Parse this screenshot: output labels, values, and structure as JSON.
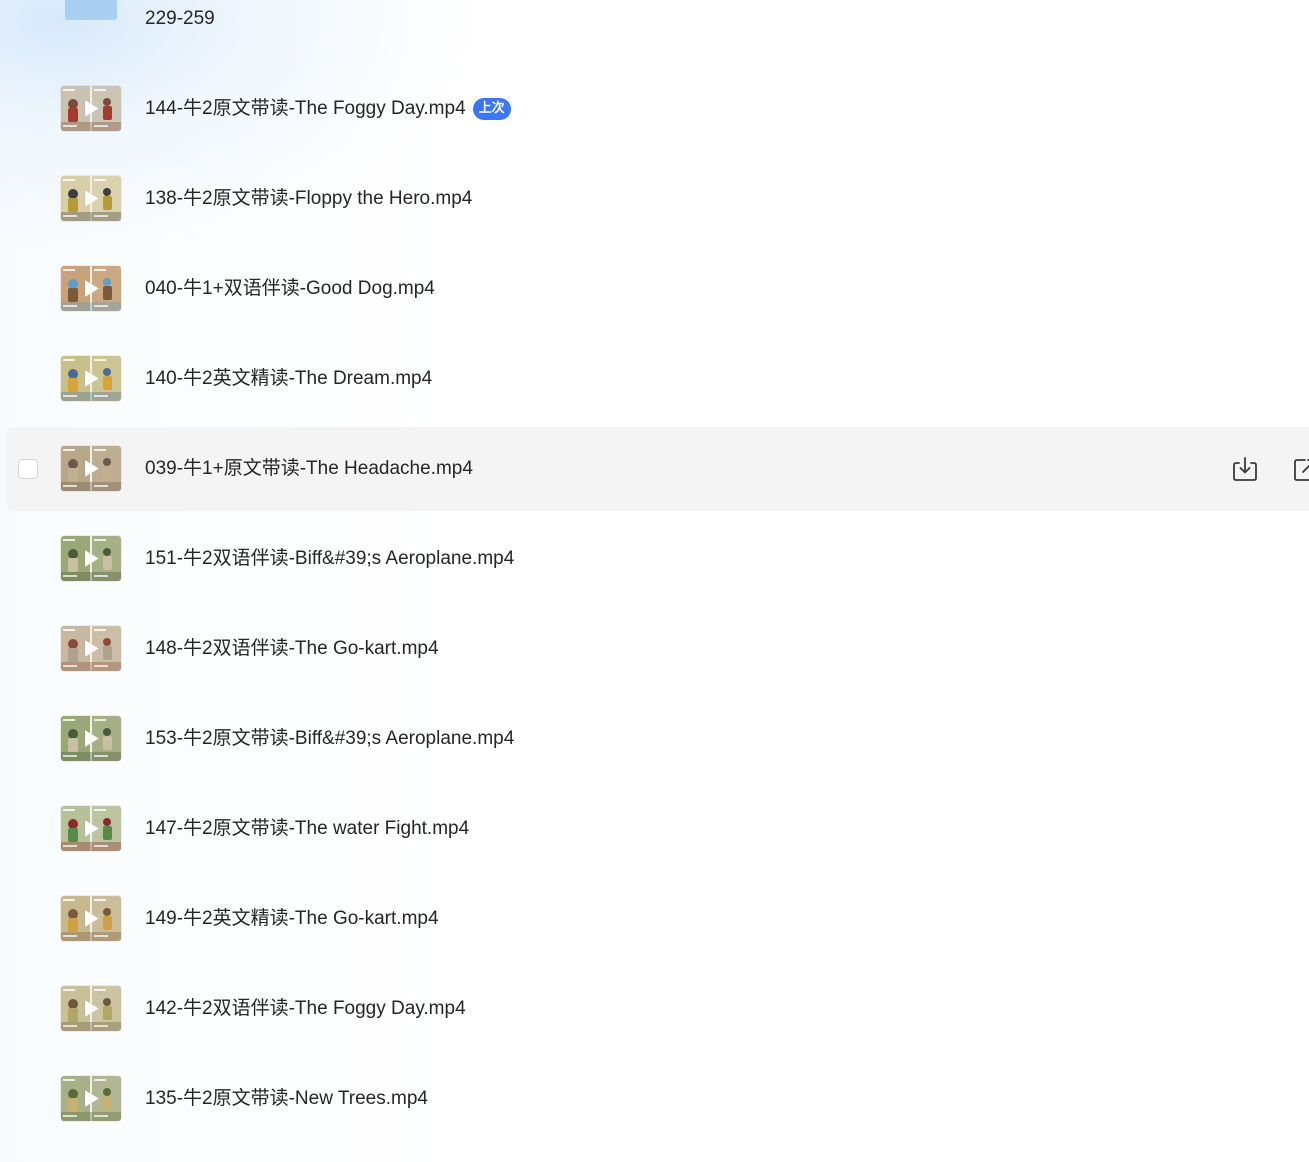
{
  "colors": {
    "accent": "#3b76f6",
    "hover_row": "#f4f4f5",
    "folder": "#8ec2f0",
    "text": "#262626"
  },
  "files": [
    {
      "name": "229-259",
      "kind": "folder",
      "icon": "folder-icon"
    },
    {
      "name": "144-牛2原文带读-The Foggy Day.mp4",
      "kind": "video",
      "badge": "上次",
      "icon": "video-thumbnail",
      "palette": [
        "#c9c2b0",
        "#7b4a3a",
        "#a33b2e",
        "#dcd6c6"
      ]
    },
    {
      "name": "138-牛2原文带读-Floppy the Hero.mp4",
      "kind": "video",
      "icon": "video-thumbnail",
      "palette": [
        "#d8cfa8",
        "#3d3d3d",
        "#b59a3a",
        "#e4dfcf"
      ]
    },
    {
      "name": "040-牛1+双语伴读-Good Dog.mp4",
      "kind": "video",
      "icon": "video-thumbnail",
      "palette": [
        "#c9a27a",
        "#5aa0c8",
        "#7a5a3a",
        "#d8c8a8"
      ]
    },
    {
      "name": "140-牛2英文精读-The Dream.mp4",
      "kind": "video",
      "icon": "video-thumbnail",
      "palette": [
        "#c8c088",
        "#4a6a9a",
        "#d9a33a",
        "#e0dccc"
      ]
    },
    {
      "name": "039-牛1+原文带读-The Headache.mp4",
      "kind": "video",
      "icon": "video-thumbnail",
      "palette": [
        "#b8a888",
        "#6a5a4a",
        "#c0b090",
        "#d8d2c2"
      ],
      "hovered": true
    },
    {
      "name": "151-牛2双语伴读-Biff&#39;s Aeroplane.mp4",
      "kind": "video",
      "icon": "video-thumbnail",
      "palette": [
        "#9aa878",
        "#4a5a3a",
        "#c8c0a0",
        "#e0dccc"
      ]
    },
    {
      "name": "148-牛2双语伴读-The Go-kart.mp4",
      "kind": "video",
      "icon": "video-thumbnail",
      "palette": [
        "#c8b8a0",
        "#8a4a3a",
        "#b0a090",
        "#dcd6c6"
      ]
    },
    {
      "name": "153-牛2原文带读-Biff&#39;s Aeroplane.mp4",
      "kind": "video",
      "icon": "video-thumbnail",
      "palette": [
        "#9aa878",
        "#4a5a3a",
        "#c8c0a0",
        "#e0dccc"
      ]
    },
    {
      "name": "147-牛2原文带读-The water Fight.mp4",
      "kind": "video",
      "icon": "video-thumbnail",
      "palette": [
        "#b8c098",
        "#8a2a2a",
        "#5a8a4a",
        "#e0dccc"
      ]
    },
    {
      "name": "149-牛2英文精读-The Go-kart.mp4",
      "kind": "video",
      "icon": "video-thumbnail",
      "palette": [
        "#c8b890",
        "#7a5a3a",
        "#d0a048",
        "#dcd6c6"
      ]
    },
    {
      "name": "142-牛2双语伴读-The Foggy Day.mp4",
      "kind": "video",
      "icon": "video-thumbnail",
      "palette": [
        "#c8c098",
        "#6a5a3a",
        "#b0a868",
        "#e0dccc"
      ]
    },
    {
      "name": "135-牛2原文带读-New Trees.mp4",
      "kind": "video",
      "icon": "video-thumbnail",
      "palette": [
        "#a8b088",
        "#5a6a3a",
        "#c8b070",
        "#e0dccc"
      ]
    }
  ],
  "row_actions": [
    {
      "name": "download-button",
      "icon": "download-icon"
    },
    {
      "name": "share-button",
      "icon": "share-icon"
    }
  ]
}
